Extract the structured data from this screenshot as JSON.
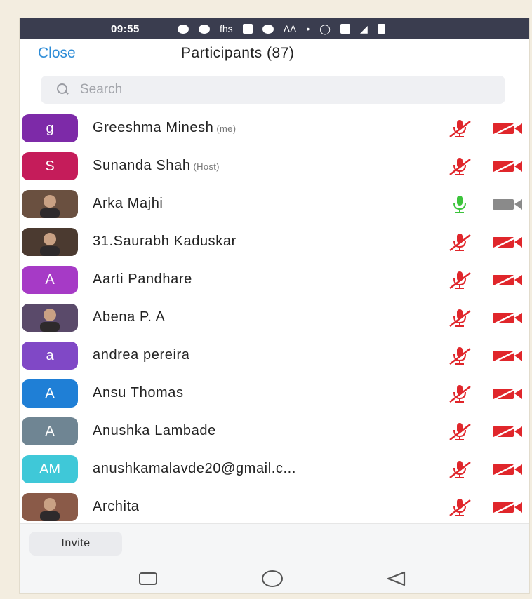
{
  "status_bar": {
    "time": "09:55",
    "icons": [
      "whatsapp-icon",
      "message-icon",
      "fhs-icon",
      "app-icon",
      "cloud-icon",
      "gmail-icon",
      "dot-icon",
      "alarm-icon",
      "volte-icon",
      "signal-icon",
      "battery-icon"
    ],
    "fhs_text": "fhs"
  },
  "header": {
    "close_label": "Close",
    "title": "Participants (87)"
  },
  "search": {
    "placeholder": "Search"
  },
  "participants": [
    {
      "initials": "g",
      "name": "Greeshma Minesh",
      "tag": "(me)",
      "avatar_color": "#7d2aa8",
      "photo": false,
      "mic": "muted",
      "video": "off"
    },
    {
      "initials": "S",
      "name": "Sunanda Shah",
      "tag": "(Host)",
      "avatar_color": "#c51c5a",
      "photo": false,
      "mic": "muted",
      "video": "off"
    },
    {
      "initials": "",
      "name": "Arka Majhi",
      "tag": "",
      "avatar_color": "#6a5040",
      "photo": true,
      "mic": "on",
      "video": "on"
    },
    {
      "initials": "",
      "name": "31.Saurabh Kaduskar",
      "tag": "",
      "avatar_color": "#4b3a30",
      "photo": true,
      "mic": "muted",
      "video": "off"
    },
    {
      "initials": "A",
      "name": "Aarti Pandhare",
      "tag": "",
      "avatar_color": "#a63ac6",
      "photo": false,
      "mic": "muted",
      "video": "off"
    },
    {
      "initials": "",
      "name": "Abena P. A",
      "tag": "",
      "avatar_color": "#5a4a6a",
      "photo": true,
      "mic": "muted",
      "video": "off"
    },
    {
      "initials": "a",
      "name": "andrea pereira",
      "tag": "",
      "avatar_color": "#8048c6",
      "photo": false,
      "mic": "muted",
      "video": "off"
    },
    {
      "initials": "A",
      "name": "Ansu Thomas",
      "tag": "",
      "avatar_color": "#1f7fd6",
      "photo": false,
      "mic": "muted",
      "video": "off"
    },
    {
      "initials": "A",
      "name": "Anushka Lambade",
      "tag": "",
      "avatar_color": "#6f8593",
      "photo": false,
      "mic": "muted",
      "video": "off"
    },
    {
      "initials": "AM",
      "name": "anushkamalavde20@gmail.c...",
      "tag": "",
      "avatar_color": "#3fc8d8",
      "photo": false,
      "mic": "muted",
      "video": "off"
    },
    {
      "initials": "",
      "name": "Archita",
      "tag": "",
      "avatar_color": "#8a5a48",
      "photo": true,
      "mic": "muted",
      "video": "off"
    }
  ],
  "footer": {
    "invite_label": "Invite"
  },
  "nav_bar": {
    "icons": [
      "recent-apps-icon",
      "home-icon",
      "back-icon"
    ]
  },
  "colors": {
    "accent": "#2d8cd7",
    "muted_red": "#e0262b",
    "mic_on_green": "#3cc43c",
    "video_on_gray": "#8a8a8a"
  }
}
